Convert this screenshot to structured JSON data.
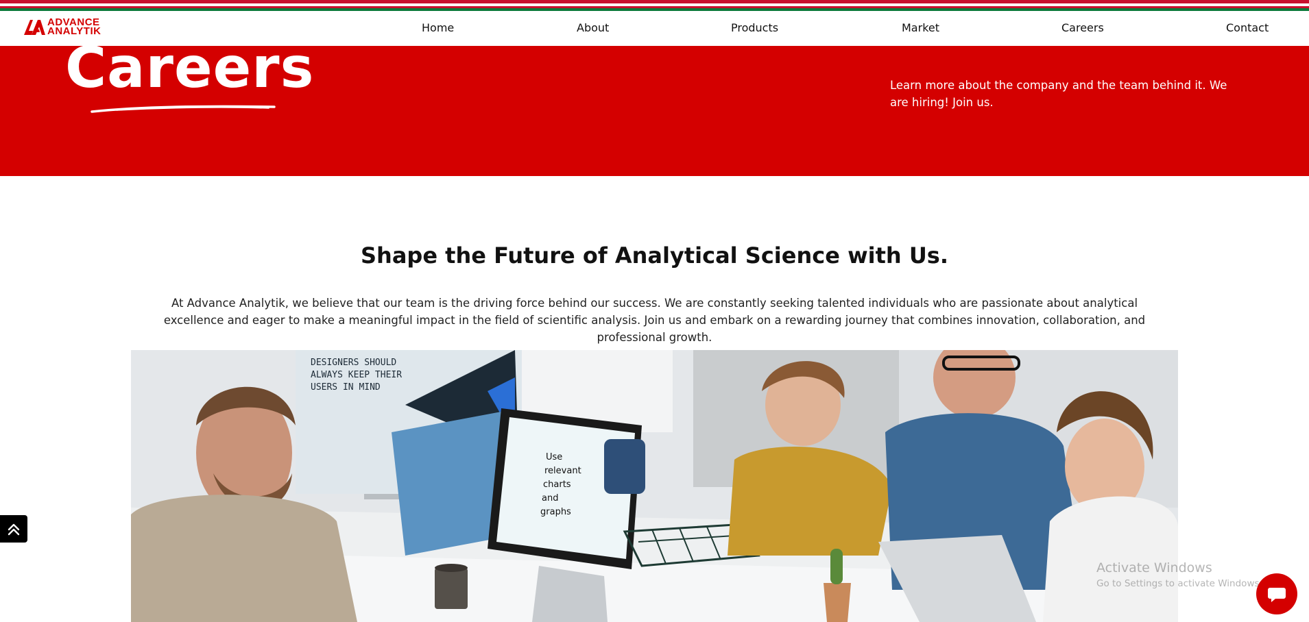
{
  "brand": {
    "logo_line1": "ADVANCE",
    "logo_line2": "ANALYTIK",
    "accent_color": "#d40000"
  },
  "nav": {
    "items": [
      {
        "label": "Home"
      },
      {
        "label": "About"
      },
      {
        "label": "Products"
      },
      {
        "label": "Market"
      },
      {
        "label": "Careers"
      },
      {
        "label": "Contact"
      }
    ]
  },
  "hero": {
    "title": "Careers",
    "text": "Learn more about the company and the team behind it. We are hiring! Join us."
  },
  "main": {
    "headline": "Shape the Future of Analytical Science with Us.",
    "intro": "At Advance Analytik, we believe that our team is the driving force behind our success. We are constantly seeking talented individuals who are passionate about analytical excellence and eager to make a meaningful impact in the field of scientific analysis. Join us and embark on a rewarding journey that combines innovation, collaboration, and professional growth.",
    "photo_screen_text": "Use relevant charts and graphs",
    "photo_poster_text": "DESIGNERS SHOULD ALWAYS KEEP THEIR USERS IN MIND"
  },
  "floating": {
    "scroll_top_icon": "double-chevron-up-icon",
    "chat_icon": "chat-bubble-icon"
  },
  "watermark": {
    "line1": "Activate Windows",
    "line2": "Go to Settings to activate Windows."
  }
}
